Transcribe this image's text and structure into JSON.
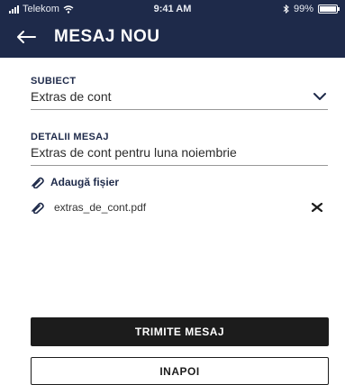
{
  "status_bar": {
    "carrier": "Telekom",
    "time": "9:41 AM",
    "battery": "99%",
    "battery_level": 0.99,
    "icons": [
      "signal-icon",
      "wifi-icon",
      "bluetooth-icon",
      "battery-icon"
    ]
  },
  "header": {
    "back_icon": "back-arrow-icon",
    "title": "MESAJ NOU"
  },
  "form": {
    "subject": {
      "label": "SUBIECT",
      "value": "Extras de cont",
      "icon": "chevron-down-icon"
    },
    "details": {
      "label": "DETALII MESAJ",
      "value": "Extras de cont pentru luna noiembrie"
    }
  },
  "attachments": {
    "add_label": "Adaugă fișier",
    "add_icon": "paperclip-icon",
    "files": [
      {
        "name": "extras_de_cont.pdf",
        "icon": "paperclip-icon",
        "remove_icon": "close-icon"
      }
    ]
  },
  "actions": {
    "send_label": "TRIMITE MESAJ",
    "back_label": "INAPOI"
  },
  "colors": {
    "header_bg": "#1e2a4a",
    "accent": "#1e2a4a",
    "primary_button": "#1c1c1c"
  }
}
